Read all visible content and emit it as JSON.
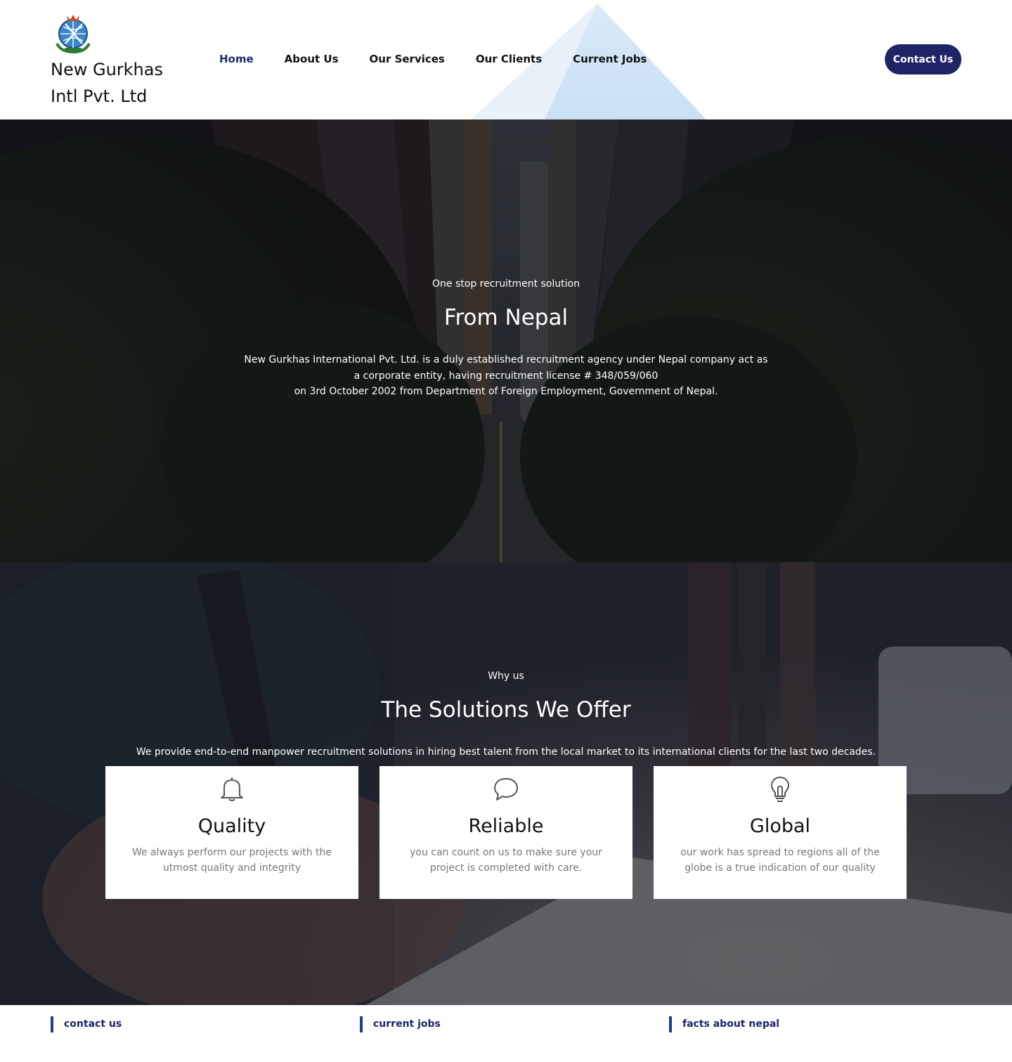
{
  "header": {
    "brand_name": "New Gurkhas Intl Pvt. Ltd",
    "brand_line1": "New Gurkhas",
    "brand_line2": "Intl Pvt. Ltd",
    "nav": [
      {
        "label": "Home",
        "active": true
      },
      {
        "label": "About Us",
        "active": false
      },
      {
        "label": "Our Services",
        "active": false
      },
      {
        "label": "Our Clients",
        "active": false
      },
      {
        "label": "Current Jobs",
        "active": false
      }
    ],
    "contact_button": "Contact Us"
  },
  "hero": {
    "kicker": "One stop recruitment solution",
    "title": "From Nepal",
    "description_lines": [
      "New Gurkhas International Pvt. Ltd. is a duly established recruitment agency under Nepal company act as",
      "a corporate entity, having recruitment license # 348/059/060",
      "on 3rd October 2002 from Department of Foreign Employment, Government of Nepal."
    ]
  },
  "why": {
    "kicker": "Why us",
    "title": "The Solutions We Offer",
    "description": "We provide end-to-end manpower recruitment solutions in hiring best talent from the local market to its international clients for the last two decades.",
    "cards": [
      {
        "icon": "bell-icon",
        "title": "Quality",
        "text": "We always perform our projects with the utmost quality and integrity"
      },
      {
        "icon": "chat-bubble-icon",
        "title": "Reliable",
        "text": "you can count on us to make sure your project is completed with care."
      },
      {
        "icon": "lightbulb-icon",
        "title": "Global",
        "text": "our work has spread to regions all of the globe is a true indication of our quality"
      }
    ]
  },
  "footer": {
    "columns": [
      "contact us",
      "current jobs",
      "facts about nepal"
    ]
  },
  "colors": {
    "brand_navy": "#1f2466",
    "accent_bar": "#1f3c8f",
    "card_text": "#777777"
  }
}
